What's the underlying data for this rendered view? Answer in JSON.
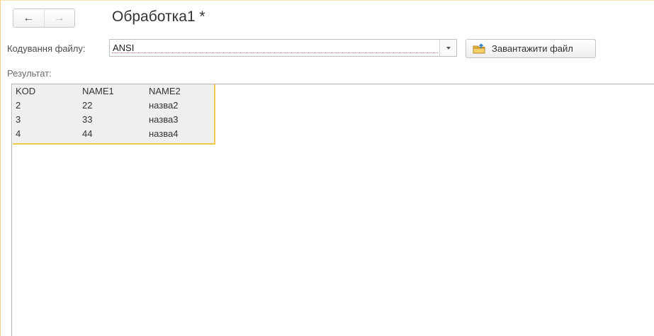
{
  "header": {
    "title": "Обработка1 *",
    "nav": {
      "back_icon": "arrow-left-icon",
      "forward_icon": "arrow-right-icon",
      "back_glyph": "←",
      "forward_glyph": "→"
    }
  },
  "encoding": {
    "label": "Кодування файлу:",
    "value": "ANSI",
    "dropdown_icon": "chevron-down-icon"
  },
  "load_button": {
    "label": "Завантажити файл",
    "icon": "folder-upload-icon"
  },
  "result": {
    "label": "Результат:",
    "columns": [
      "KOD",
      "NAME1",
      "NAME2"
    ],
    "rows": [
      [
        "2",
        "22",
        "назва2"
      ],
      [
        "3",
        "33",
        "назва3"
      ],
      [
        "4",
        "44",
        "назва4"
      ]
    ]
  },
  "colors": {
    "highlight_border": "#f2c94c",
    "frame_border": "#f0d28c",
    "table_background": "#efefef"
  }
}
